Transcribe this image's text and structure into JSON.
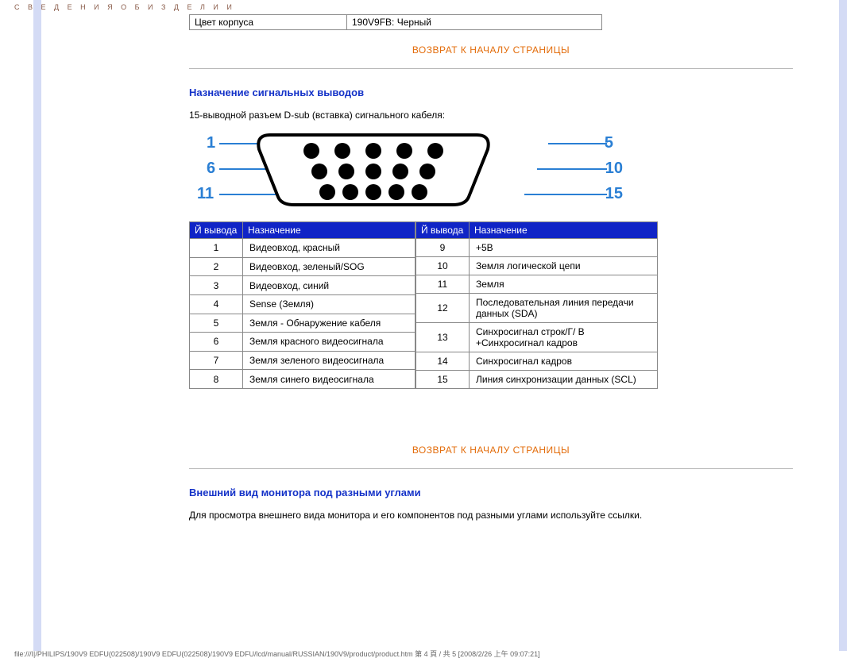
{
  "doc_title": "С В Е Д Е Н И Я  О Б  И З Д Е Л И И",
  "footer": "file:///I|/PHILIPS/190V9 EDFU(022508)/190V9 EDFU(022508)/190V9 EDFU/lcd/manual/RUSSIAN/190V9/product/product.htm 第 4 頁 / 共 5  [2008/2/26 上午 09:07:21]",
  "spec_row": {
    "col1": "Цвет корпуса",
    "col2": "190V9FB: Черный"
  },
  "back_to_top": "ВОЗВРАТ К НАЧАЛУ СТРАНИЦЫ",
  "section1_title": "Назначение сигнальных выводов",
  "dsub_intro": "15-выводной разъем D-sub (вставка) сигнального кабеля:",
  "pin_labels": {
    "r1l": "1",
    "r1r": "5",
    "r2l": "6",
    "r2r": "10",
    "r3l": "11",
    "r3r": "15"
  },
  "pin_header": {
    "col_num": "Й вывода",
    "col_desc": "Назначение"
  },
  "pins_left": [
    {
      "n": "1",
      "d": "Видеовход, красный"
    },
    {
      "n": "2",
      "d": "Видеовход, зеленый/SOG"
    },
    {
      "n": "3",
      "d": "Видеовход, синий"
    },
    {
      "n": "4",
      "d": "Sense (Земля)"
    },
    {
      "n": "5",
      "d": "Земля - Обнаружение кабеля"
    },
    {
      "n": "6",
      "d": "Земля красного видеосигнала"
    },
    {
      "n": "7",
      "d": "Земля зеленого видеосигнала"
    },
    {
      "n": "8",
      "d": "Земля синего видеосигнала"
    }
  ],
  "pins_right": [
    {
      "n": "9",
      "d": "+5В"
    },
    {
      "n": "10",
      "d": "Земля логической цепи"
    },
    {
      "n": "11",
      "d": "Земля"
    },
    {
      "n": "12",
      "d": "Последовательная линия передачи данных (SDA)"
    },
    {
      "n": "13",
      "d": "Синхросигнал строк/Г/ В +Синхросигнал кадров"
    },
    {
      "n": "14",
      "d": "Синхросигнал кадров"
    },
    {
      "n": "15",
      "d": "Линия синхронизации данных (SCL)"
    }
  ],
  "section2_title": "Внешний вид монитора под разными углами",
  "section2_body": "Для просмотра внешнего вида монитора и его компонентов под разными углами используйте ссылки."
}
